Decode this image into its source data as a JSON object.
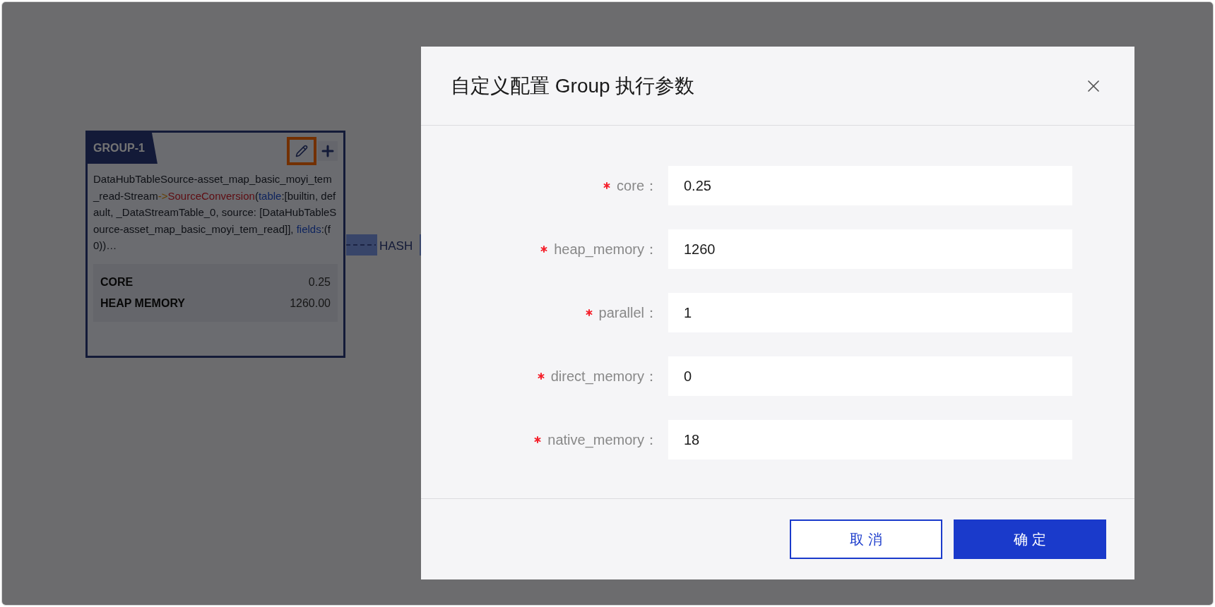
{
  "canvas": {
    "group": {
      "title": "GROUP-1",
      "edit_button": {
        "highlighted": true
      },
      "description": [
        {
          "kind": "plain",
          "text": "DataHubTableSource-asset_map_basic_moyi_tem_read-Stream"
        },
        {
          "kind": "arrow",
          "text": "->"
        },
        {
          "kind": "operator",
          "text": "SourceConversion"
        },
        {
          "kind": "plain",
          "text": "("
        },
        {
          "kind": "key",
          "text": "table"
        },
        {
          "kind": "plain",
          "text": ":[builtin, default, _DataStreamTable_0, source: [DataHubTableSource-asset_map_basic_moyi_tem_read]], "
        },
        {
          "kind": "key",
          "text": "fields"
        },
        {
          "kind": "plain",
          "text": ":(f0))…"
        }
      ],
      "metrics": [
        {
          "label": "CORE",
          "value": "0.25"
        },
        {
          "label": "HEAP MEMORY",
          "value": "1260.00"
        }
      ]
    },
    "edge": {
      "label": "HASH"
    }
  },
  "dialog": {
    "title": "自定义配置 Group 执行参数",
    "fields": [
      {
        "label": "core：",
        "value": "0.25",
        "required": true
      },
      {
        "label": "heap_memory：",
        "value": "1260",
        "required": true
      },
      {
        "label": "parallel：",
        "value": "1",
        "required": true
      },
      {
        "label": "direct_memory：",
        "value": "0",
        "required": true
      },
      {
        "label": "native_memory：",
        "value": "18",
        "required": true
      }
    ],
    "buttons": [
      {
        "label": "取 消",
        "kind": "secondary"
      },
      {
        "label": "确 定",
        "kind": "primary"
      }
    ]
  }
}
